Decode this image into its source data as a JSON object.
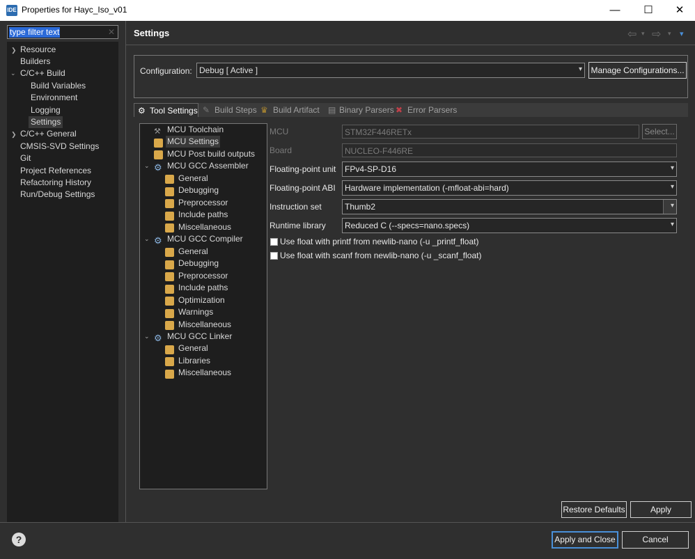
{
  "window": {
    "app_icon": "IDE",
    "title": "Properties for Hayc_Iso_v01",
    "minimize": "—",
    "maximize": "☐",
    "close": "✕"
  },
  "filter": {
    "placeholder": "type filter text",
    "value": "type filter text",
    "clear": "✕"
  },
  "nav": {
    "items": [
      {
        "label": "Resource"
      },
      {
        "label": "Builders"
      },
      {
        "label": "C/C++ Build"
      },
      {
        "label": "Build Variables"
      },
      {
        "label": "Environment"
      },
      {
        "label": "Logging"
      },
      {
        "label": "Settings"
      },
      {
        "label": "C/C++ General"
      },
      {
        "label": "CMSIS-SVD Settings"
      },
      {
        "label": "Git"
      },
      {
        "label": "Project References"
      },
      {
        "label": "Refactoring History"
      },
      {
        "label": "Run/Debug Settings"
      }
    ]
  },
  "header": {
    "title": "Settings",
    "back": "⇦",
    "forward": "⇨",
    "menu": "▾"
  },
  "config": {
    "label": "Configuration:",
    "value": "Debug  [ Active ]",
    "manage_button": "Manage Configurations..."
  },
  "tabs": [
    {
      "label": "Tool Settings"
    },
    {
      "label": "Build Steps"
    },
    {
      "label": "Build Artifact"
    },
    {
      "label": "Binary Parsers"
    },
    {
      "label": "Error Parsers"
    }
  ],
  "tool_tree": [
    {
      "label": "MCU Toolchain"
    },
    {
      "label": "MCU Settings"
    },
    {
      "label": "MCU Post build outputs"
    },
    {
      "label": "MCU GCC Assembler"
    },
    {
      "label": "General"
    },
    {
      "label": "Debugging"
    },
    {
      "label": "Preprocessor"
    },
    {
      "label": "Include paths"
    },
    {
      "label": "Miscellaneous"
    },
    {
      "label": "MCU GCC Compiler"
    },
    {
      "label": "General"
    },
    {
      "label": "Debugging"
    },
    {
      "label": "Preprocessor"
    },
    {
      "label": "Include paths"
    },
    {
      "label": "Optimization"
    },
    {
      "label": "Warnings"
    },
    {
      "label": "Miscellaneous"
    },
    {
      "label": "MCU GCC Linker"
    },
    {
      "label": "General"
    },
    {
      "label": "Libraries"
    },
    {
      "label": "Miscellaneous"
    }
  ],
  "form": {
    "mcu_label": "MCU",
    "mcu_value": "STM32F446RETx",
    "select_button": "Select...",
    "board_label": "Board",
    "board_value": "NUCLEO-F446RE",
    "fpu_label": "Floating-point unit",
    "fpu_value": "FPv4-SP-D16",
    "abi_label": "Floating-point ABI",
    "abi_value": "Hardware implementation (-mfloat-abi=hard)",
    "iset_label": "Instruction set",
    "iset_value": "Thumb2",
    "runtime_label": "Runtime library",
    "runtime_value": "Reduced C (--specs=nano.specs)",
    "printf_label": "Use float with printf from newlib-nano (-u _printf_float)",
    "scanf_label": "Use float with scanf from newlib-nano (-u _scanf_float)"
  },
  "buttons": {
    "restore": "Restore Defaults",
    "apply": "Apply",
    "apply_close": "Apply and Close",
    "cancel": "Cancel",
    "help": "?"
  },
  "colors": {
    "accent": "#4a90d9",
    "selection": "#2b6ad8",
    "background": "#2f2f2f"
  }
}
